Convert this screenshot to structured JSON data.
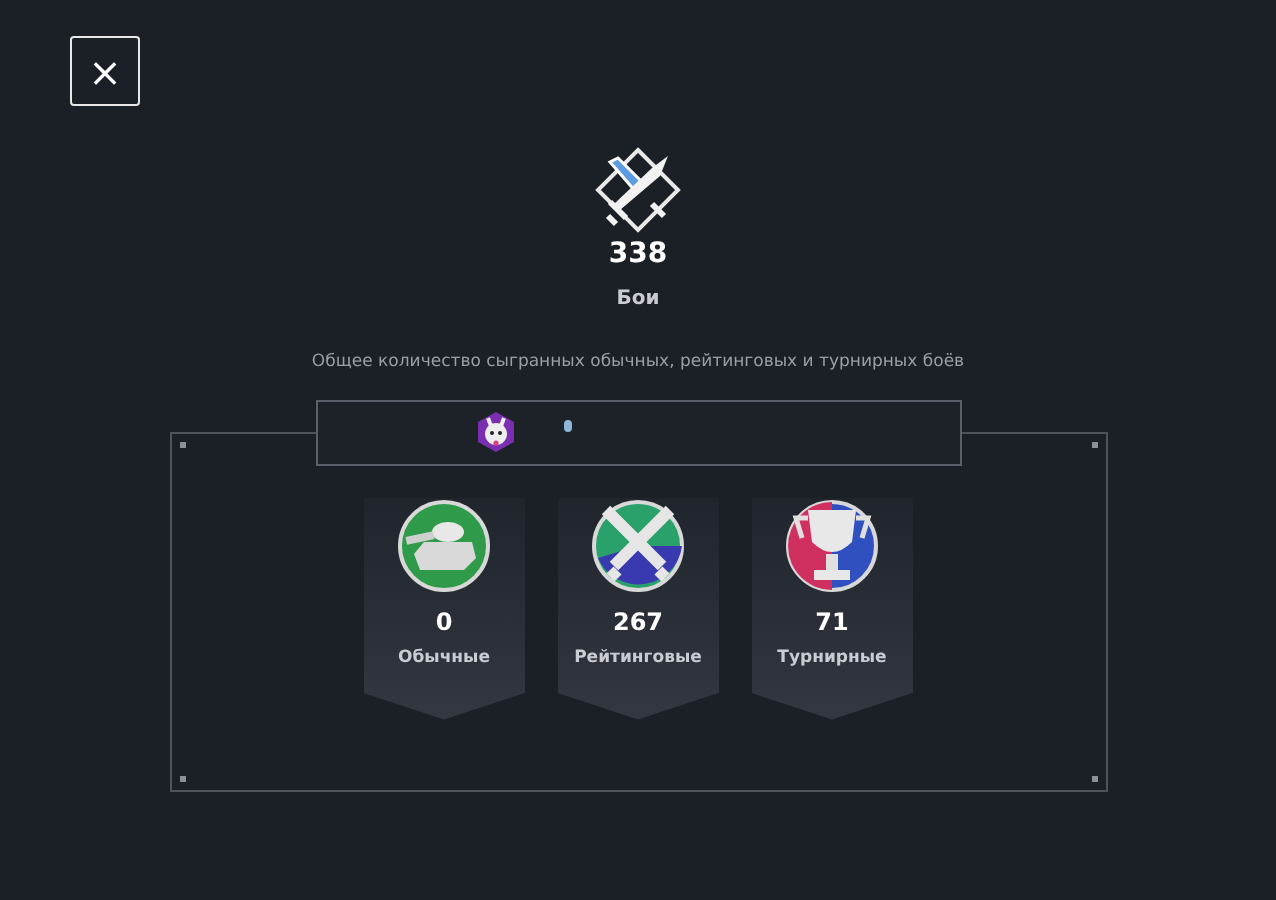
{
  "close_button": {
    "label": "×"
  },
  "summary": {
    "value": "338",
    "label": "Бои",
    "description": "Общее количество сыгранных обычных, рейтинговых и турнирных боёв"
  },
  "modes": [
    {
      "kind": "tank",
      "value": "0",
      "label": "Обычные"
    },
    {
      "kind": "swords",
      "value": "267",
      "label": "Рейтинговые"
    },
    {
      "kind": "trophy",
      "value": "71",
      "label": "Турнирные"
    }
  ]
}
